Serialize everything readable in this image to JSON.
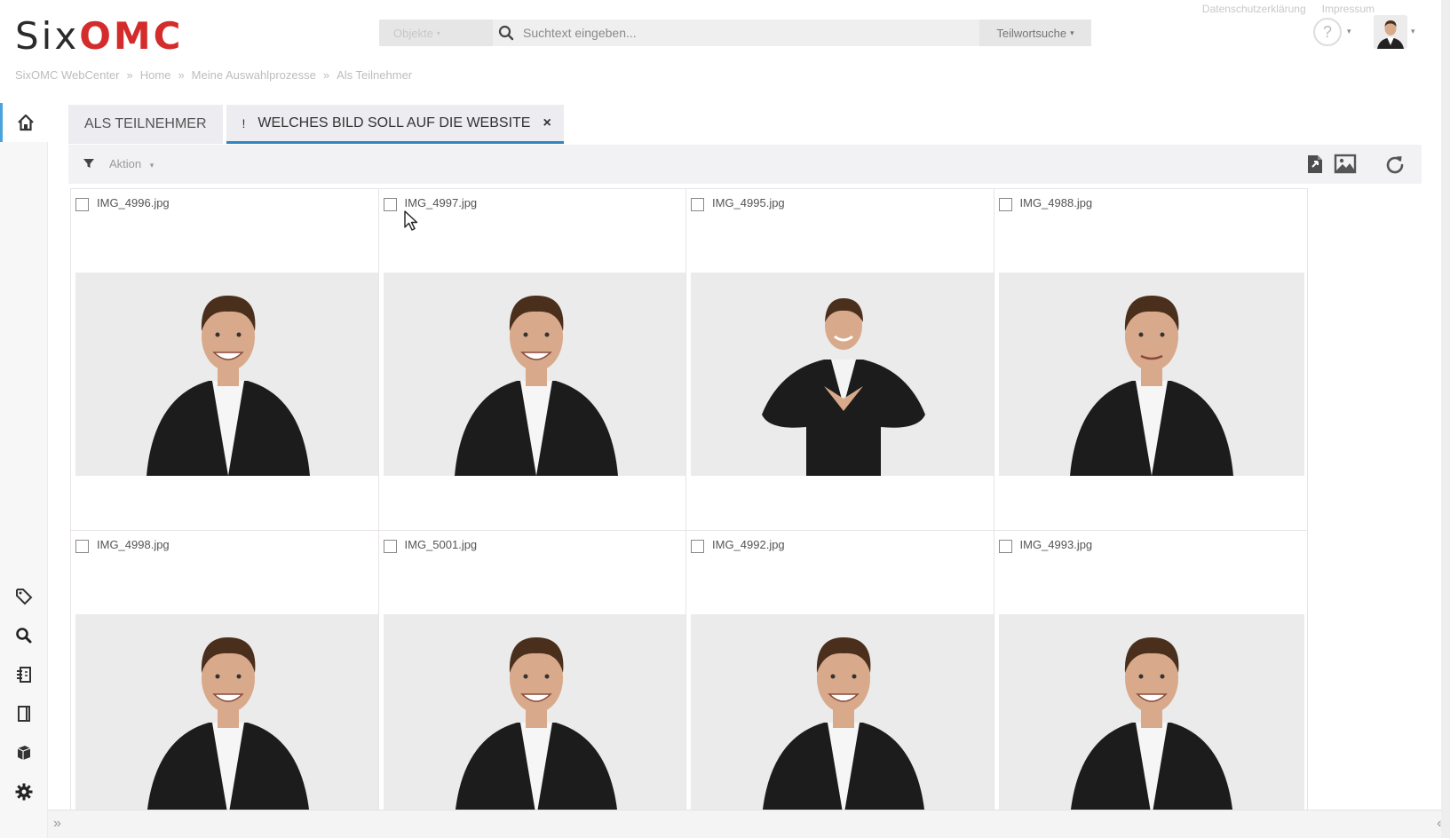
{
  "logo": {
    "part1": "Six",
    "part2": "OMC"
  },
  "top_links": {
    "privacy": "Datenschutzerklärung",
    "imprint": "Impressum"
  },
  "search": {
    "object_type": "Objekte",
    "placeholder": "Suchtext eingeben...",
    "mode": "Teilwortsuche"
  },
  "help": {
    "symbol": "?"
  },
  "breadcrumb": [
    "SixOMC WebCenter",
    "Home",
    "Meine Auswahlprozesse",
    "Als Teilnehmer"
  ],
  "breadcrumb_sep": "»",
  "tabs": [
    {
      "label": "ALS TEILNEHMER",
      "active": false
    },
    {
      "label": "WELCHES BILD SOLL AUF DIE WEBSITE",
      "prefix": "!",
      "active": true,
      "close": "×"
    }
  ],
  "toolbar": {
    "action_label": "Aktion"
  },
  "images": [
    {
      "filename": "IMG_4996.jpg",
      "pose": "smile"
    },
    {
      "filename": "IMG_4997.jpg",
      "pose": "smile"
    },
    {
      "filename": "IMG_4995.jpg",
      "pose": "heart"
    },
    {
      "filename": "IMG_4988.jpg",
      "pose": "neutral"
    },
    {
      "filename": "IMG_4998.jpg",
      "pose": "smile"
    },
    {
      "filename": "IMG_5001.jpg",
      "pose": "smile"
    },
    {
      "filename": "IMG_4992.jpg",
      "pose": "smile"
    },
    {
      "filename": "IMG_4993.jpg",
      "pose": "smile"
    }
  ],
  "bottom": {
    "expand": "»",
    "collapse": "«"
  },
  "colors": {
    "brand_red": "#d42b2b",
    "accent_blue": "#2e86c1",
    "sidebar_bg": "#f7f7f7",
    "toolbar_bg": "#f2f2f5"
  }
}
